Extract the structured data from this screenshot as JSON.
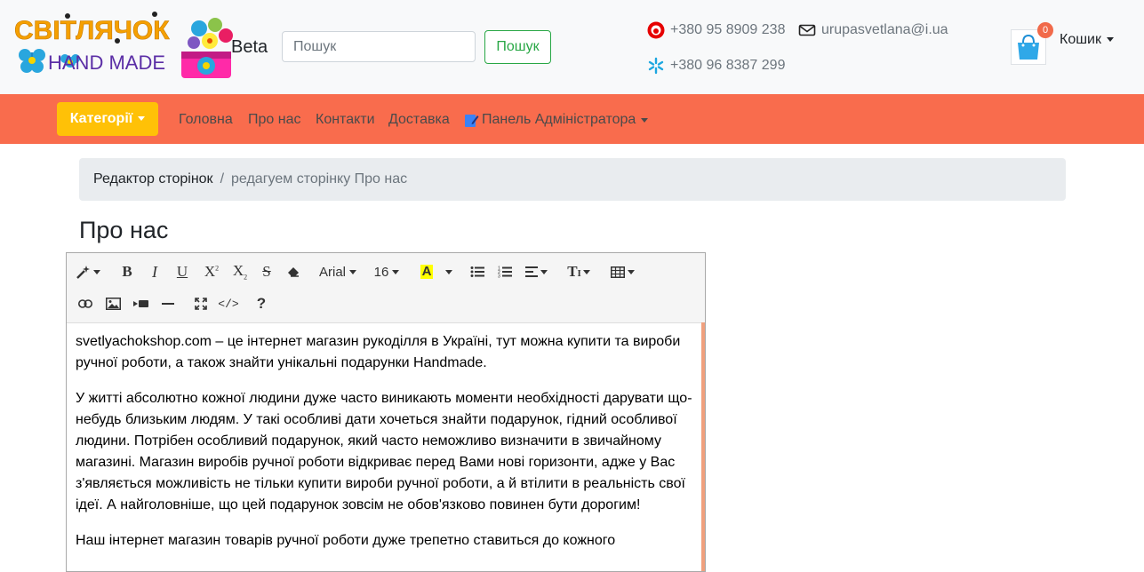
{
  "header": {
    "logo_text_top": "СВІТЛЯЧОК",
    "logo_text_bottom": "HAND MADE",
    "beta_label": "Beta",
    "search": {
      "placeholder": "Пошук",
      "value": "",
      "button_label": "Пошук"
    },
    "contacts": {
      "phone_vodafone": "+380 95 8909 238",
      "email": "urupasvetlana@i.ua",
      "phone_kyivstar": "+380 96 8387 299"
    },
    "cart": {
      "count": "0",
      "label": "Кошик"
    }
  },
  "colors": {
    "navbar": "#f96c4d",
    "categories_button": "#ffc107",
    "search_button": "#28a745",
    "badge": "#f16a4a"
  },
  "nav": {
    "categories_label": "Категорії",
    "links": [
      "Головна",
      "Про нас",
      "Контакти",
      "Доставка"
    ],
    "admin_label": "Панель Адміністратора"
  },
  "breadcrumb": {
    "active": "Редактор сторінок",
    "current": "редагуем сторінку Про нас"
  },
  "page_title": "Про нас",
  "editor": {
    "toolbar": {
      "font_family": "Arial",
      "font_size": "16",
      "icons": [
        "magic-icon",
        "bold-icon",
        "italic-icon",
        "underline-icon",
        "superscript-icon",
        "subscript-icon",
        "strikethrough-icon",
        "eraser-icon",
        "text-color-icon",
        "unordered-list-icon",
        "ordered-list-icon",
        "align-icon",
        "line-height-icon",
        "table-icon",
        "link-icon",
        "image-icon",
        "video-icon",
        "horizontal-rule-icon",
        "fullscreen-icon",
        "code-view-icon",
        "help-icon"
      ]
    },
    "paragraphs": [
      "svetlyachokshop.com – це інтернет магазин рукоділля в Україні, тут можна купити та вироби ручної роботи, а також знайти унікальні подарунки Handmade.",
      "У житті абсолютно кожної людини дуже часто виникають моменти необхідності дарувати що-небудь близьким людям. У такі особливі дати хочеться знайти подарунок, гідний особливої людини. Потрібен особливий подарунок, який часто неможливо визначити в звичайному магазині. Магазин виробів ручної роботи відкриває перед Вами нові горизонти, адже у Вас з'являється можливість не тільки купити вироби ручної роботи, а й втілити в реальність свої ідеї. А найголовніше, що цей подарунок зовсім не обов'язково повинен бути дорогим!",
      "Наш інтернет магазин товарів ручної роботи дуже трепетно ставиться до кожного"
    ]
  }
}
